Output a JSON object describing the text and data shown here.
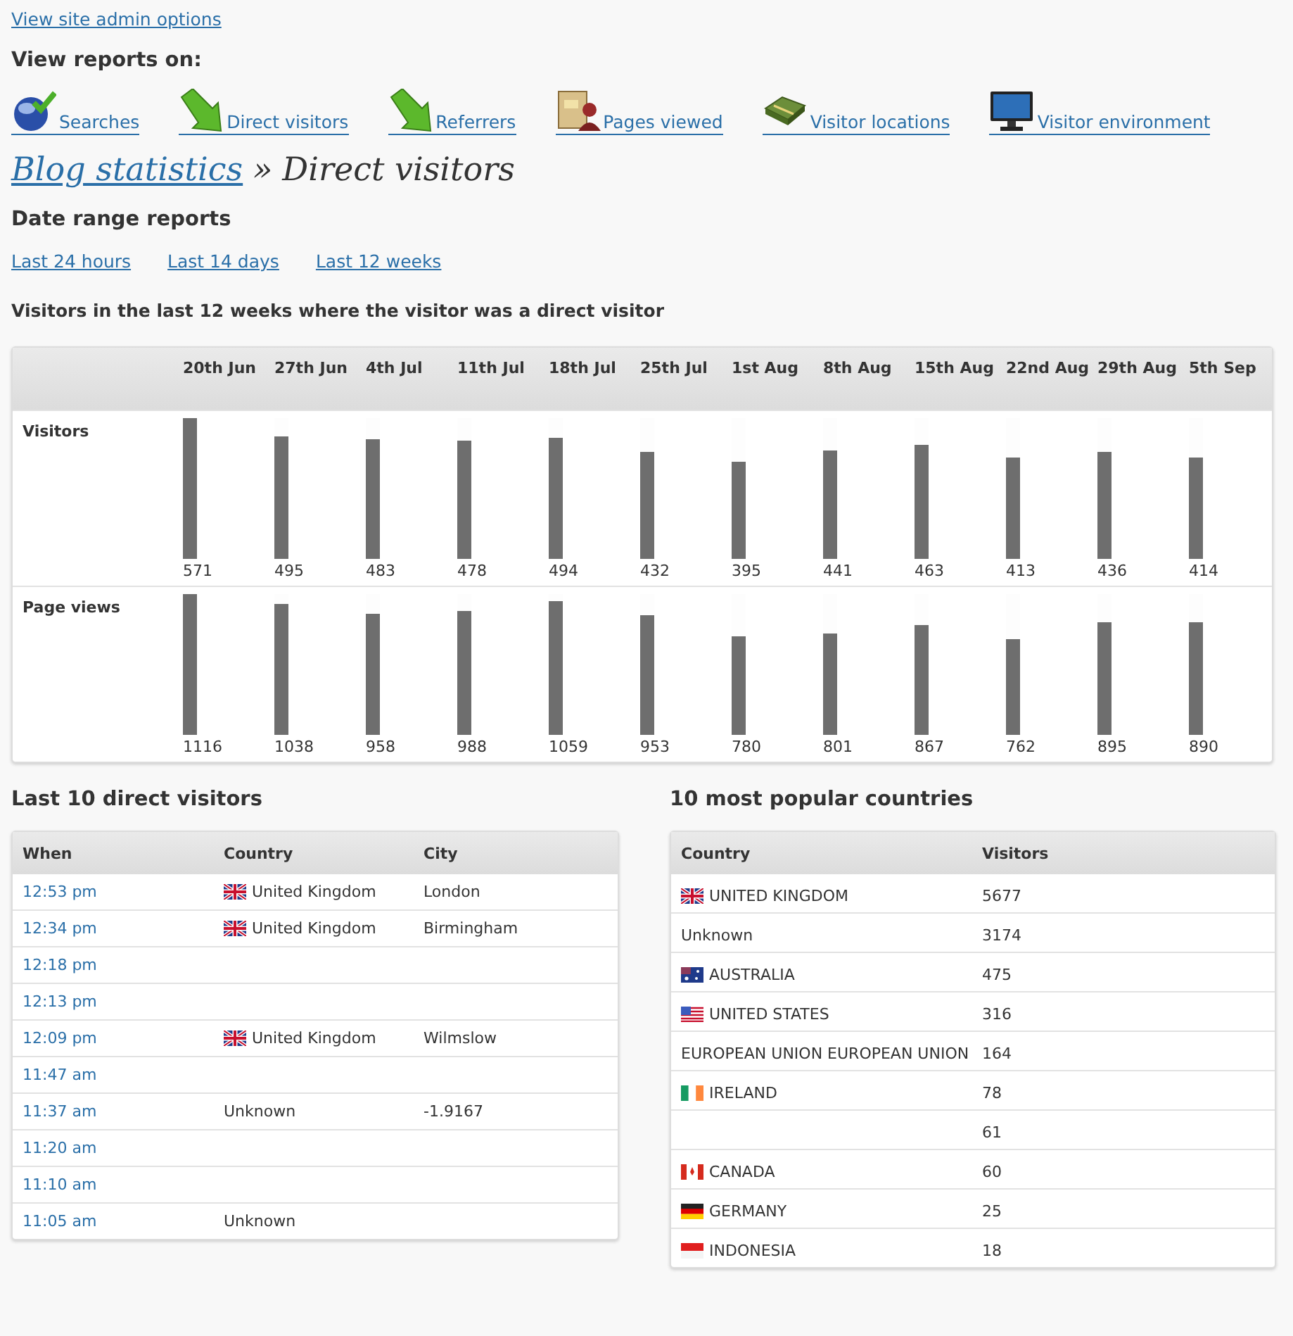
{
  "admin_link": "View site admin options",
  "reports_heading": "View reports on:",
  "report_links": [
    {
      "kind": "globe",
      "label": "Searches"
    },
    {
      "kind": "arrow",
      "label": "Direct visitors"
    },
    {
      "kind": "arrow",
      "label": "Referrers"
    },
    {
      "kind": "folder",
      "label": "Pages viewed"
    },
    {
      "kind": "map",
      "label": "Visitor locations"
    },
    {
      "kind": "monitor",
      "label": "Visitor environment"
    }
  ],
  "breadcrumb": {
    "link": "Blog statistics",
    "separator": "»",
    "current": "Direct visitors"
  },
  "date_range": {
    "heading": "Date range reports",
    "links": [
      "Last 24 hours",
      "Last 14 days",
      "Last 12 weeks"
    ]
  },
  "stats_title": "Visitors in the last 12 weeks where the visitor was a direct visitor",
  "stats_table": {
    "columns": [
      "20th Jun",
      "27th Jun",
      "4th Jul",
      "11th Jul",
      "18th Jul",
      "25th Jul",
      "1st Aug",
      "8th Aug",
      "15th Aug",
      "22nd Aug",
      "29th Aug",
      "5th Sep"
    ],
    "rows": [
      {
        "label": "Visitors",
        "cells": [
          {
            "value": "571",
            "level": 1
          },
          {
            "value": "495",
            "level": 0.867
          },
          {
            "value": "483",
            "level": 0.846
          },
          {
            "value": "478",
            "level": 0.837
          },
          {
            "value": "494",
            "level": 0.865
          },
          {
            "value": "432",
            "level": 0.757
          },
          {
            "value": "395",
            "level": 0.692
          },
          {
            "value": "441",
            "level": 0.772
          },
          {
            "value": "463",
            "level": 0.811
          },
          {
            "value": "413",
            "level": 0.723
          },
          {
            "value": "436",
            "level": 0.764
          },
          {
            "value": "414",
            "level": 0.725
          }
        ]
      },
      {
        "label": "Page views",
        "cells": [
          {
            "value": "1116",
            "level": 1
          },
          {
            "value": "1038",
            "level": 0.93
          },
          {
            "value": "958",
            "level": 0.858
          },
          {
            "value": "988",
            "level": 0.885
          },
          {
            "value": "1059",
            "level": 0.949
          },
          {
            "value": "953",
            "level": 0.854
          },
          {
            "value": "780",
            "level": 0.699
          },
          {
            "value": "801",
            "level": 0.718
          },
          {
            "value": "867",
            "level": 0.777
          },
          {
            "value": "762",
            "level": 0.683
          },
          {
            "value": "895",
            "level": 0.802
          },
          {
            "value": "890",
            "level": 0.797
          }
        ]
      }
    ]
  },
  "last_visitors": {
    "title": "Last 10 direct visitors",
    "columns": [
      "When",
      "Country",
      "City"
    ],
    "rows": [
      {
        "when": "12:53 pm",
        "kind": "gb",
        "country": "United Kingdom",
        "city": "London"
      },
      {
        "when": "12:34 pm",
        "kind": "gb",
        "country": "United Kingdom",
        "city": "Birmingham"
      },
      {
        "when": "12:18 pm"
      },
      {
        "when": "12:13 pm"
      },
      {
        "when": "12:09 pm",
        "kind": "gb",
        "country": "United Kingdom",
        "city": "Wilmslow"
      },
      {
        "when": "11:47 am"
      },
      {
        "when": "11:37 am",
        "country": "Unknown",
        "city": "-1.9167"
      },
      {
        "when": "11:20 am"
      },
      {
        "when": "11:10 am"
      },
      {
        "when": "11:05 am",
        "country": "Unknown"
      }
    ]
  },
  "popular_countries": {
    "title": "10 most popular countries",
    "columns": [
      "Country",
      "Visitors"
    ],
    "rows": [
      {
        "kind": "gb",
        "country": "UNITED KINGDOM",
        "visitors": "5677"
      },
      {
        "country": "Unknown",
        "visitors": "3174"
      },
      {
        "kind": "au",
        "country": "AUSTRALIA",
        "visitors": "475"
      },
      {
        "kind": "us",
        "country": "UNITED STATES",
        "visitors": "316"
      },
      {
        "country": "EUROPEAN UNION EUROPEAN UNION",
        "visitors": "164"
      },
      {
        "kind": "ie",
        "country": "IRELAND",
        "visitors": "78"
      },
      {
        "visitors": "61"
      },
      {
        "kind": "ca",
        "country": "CANADA",
        "visitors": "60"
      },
      {
        "kind": "de",
        "country": "GERMANY",
        "visitors": "25"
      },
      {
        "kind": "id",
        "country": "INDONESIA",
        "visitors": "18"
      }
    ]
  }
}
